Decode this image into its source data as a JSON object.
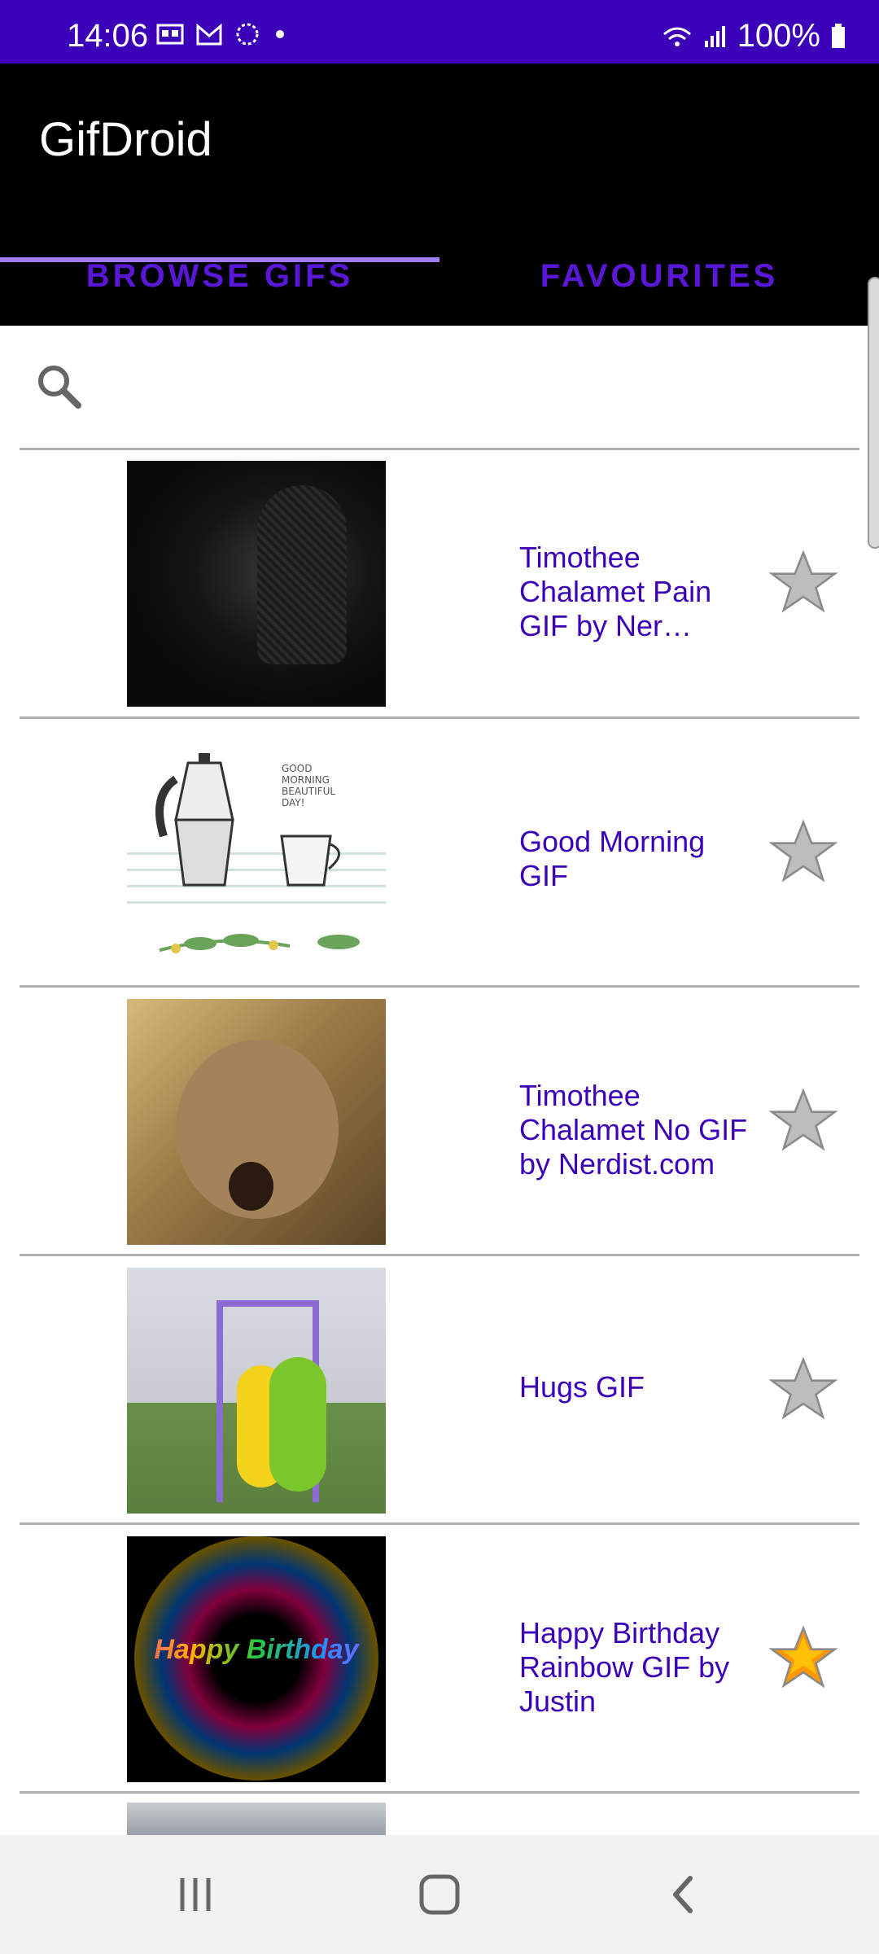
{
  "status_bar": {
    "time": "14:06",
    "battery_percent": "100%",
    "icons_left": [
      "calendar-icon",
      "gmail-icon",
      "sync-icon",
      "dot-icon"
    ],
    "icons_right": [
      "wifi-icon",
      "signal-icon",
      "battery-icon"
    ]
  },
  "app": {
    "title": "GifDroid",
    "tabs": [
      {
        "label": "BROWSE GIFS",
        "selected": true
      },
      {
        "label": "FAVOURITES",
        "selected": false
      }
    ]
  },
  "search": {
    "icon": "search-icon",
    "placeholder": "",
    "value": ""
  },
  "items": [
    {
      "title": "Timothee Chalamet Pain GIF by Ner…",
      "favorite": false
    },
    {
      "title": "Good Morning GIF",
      "favorite": false
    },
    {
      "title": "Timothee Chalamet No GIF by Nerdist.com",
      "favorite": false
    },
    {
      "title": "Hugs GIF",
      "favorite": false
    },
    {
      "title": "Happy Birthday Rainbow GIF by Justin",
      "favorite": true
    }
  ],
  "thumb_texts": {
    "good_morning": "GOOD MORNING BEAUTIFUL DAY!",
    "birthday": "Happy Birthday"
  },
  "colors": {
    "status_bar": "#3c00b8",
    "accent": "#5b17d7",
    "indicator": "#a27af3",
    "title_text": "#3c00b8",
    "star_off": "#bdbdbd",
    "star_on": "#ff9800"
  }
}
